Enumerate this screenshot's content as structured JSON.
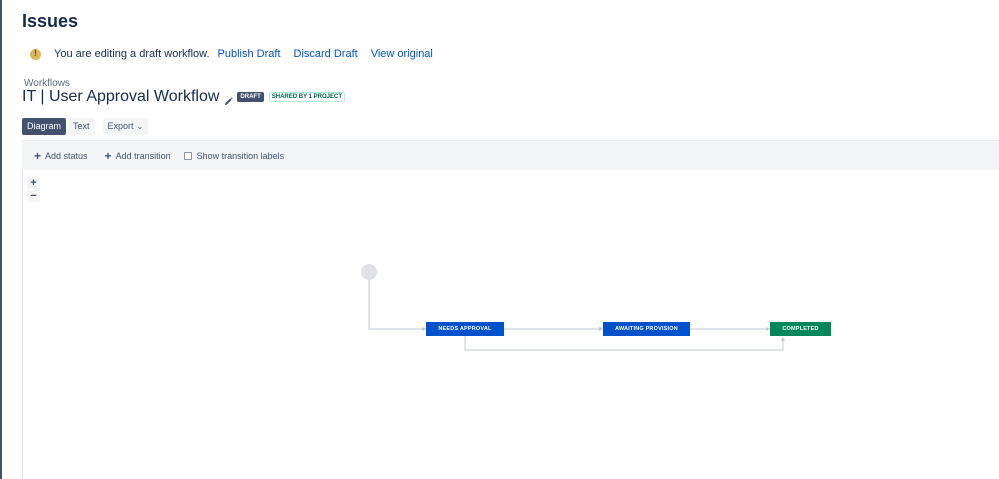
{
  "page": {
    "title": "Issues"
  },
  "draft_bar": {
    "icon": "warning-icon",
    "message": "You are editing a draft workflow.",
    "publish_label": "Publish Draft",
    "discard_label": "Discard Draft",
    "view_original_label": "View original"
  },
  "workflow": {
    "breadcrumb": "Workflows",
    "title": "IT | User Approval Workflow",
    "draft_lozenge": "DRAFT",
    "shared_prefix": "SHARED BY ",
    "shared_count": "1",
    "shared_suffix": " PROJECT"
  },
  "view_tabs": {
    "diagram": "Diagram",
    "text": "Text",
    "export": "Export"
  },
  "toolbar": {
    "add_status": "Add status",
    "add_transition": "Add transition",
    "show_labels": "Show transition labels",
    "show_labels_checked": false
  },
  "zoom": {
    "in": "+",
    "out": "−"
  },
  "statuses": [
    {
      "label": "NEEDS APPROVAL",
      "color": "#0052cc"
    },
    {
      "label": "AWAITING PROVISION",
      "color": "#0052cc"
    },
    {
      "label": "COMPLETED",
      "color": "#00875a"
    }
  ],
  "colors": {
    "accent": "#0052cc",
    "done": "#00875a",
    "tab_active": "#42526e",
    "link": "#0052cc"
  }
}
